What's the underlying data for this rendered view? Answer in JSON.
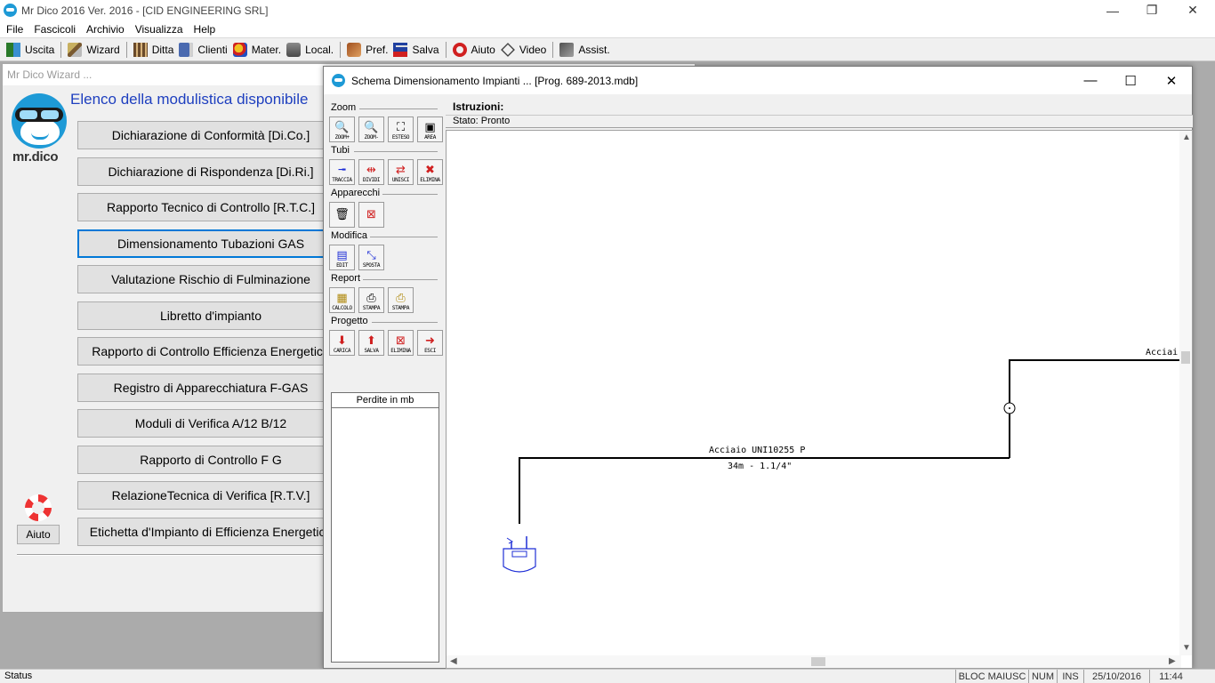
{
  "app": {
    "title": "Mr Dico 2016 Ver. 2016  -  [CID ENGINEERING SRL]",
    "controls": {
      "minimize": "—",
      "restore": "❐",
      "close": "✕"
    }
  },
  "menu": [
    "File",
    "Fascicoli",
    "Archivio",
    "Visualizza",
    "Help"
  ],
  "toolbar": {
    "uscita": "Uscita",
    "wizard": "Wizard",
    "ditta": "Ditta",
    "clienti": "Clienti",
    "mater": "Mater.",
    "local": "Local.",
    "pref": "Pref.",
    "salva": "Salva",
    "aiuto": "Aiuto",
    "video": "Video",
    "assist": "Assist."
  },
  "wizard": {
    "title": "Mr Dico Wizard ...",
    "logo_text": "mr.dico",
    "heading": "Elenco della modulistica disponibile",
    "buttons": [
      "Dichiarazione di Conformità [Di.Co.]",
      "Dichiarazione di Rispondenza [Di.Ri.]",
      "Rapporto Tecnico di Controllo [R.T.C.]",
      "Dimensionamento Tubazioni GAS",
      "Valutazione Rischio di Fulminazione",
      "Libretto d'impianto",
      "Rapporto di Controllo Efficienza Energetica",
      "Registro di Apparecchiatura F-GAS",
      "Moduli di Verifica A/12 B/12",
      "Rapporto di Controllo F G",
      "RelazioneTecnica di Verifica [R.T.V.]",
      "Etichetta d'Impianto di Efficienza Energetica"
    ],
    "aiuto": "Aiuto"
  },
  "schema": {
    "title": "Schema Dimensionamento Impianti ...   [Prog. 689-2013.mdb]",
    "controls": {
      "minimize": "—",
      "maximize": "☐",
      "close": "✕"
    },
    "groups": {
      "zoom": "Zoom",
      "tubi": "Tubi",
      "apparecchi": "Apparecchi",
      "modifica": "Modifica",
      "report": "Report",
      "progetto": "Progetto"
    },
    "tools": {
      "zoom_in": "ZOOM+",
      "zoom_out": "ZOOM-",
      "esteso": "ESTESO",
      "area": "AREA",
      "traccia": "TRACCIA",
      "dividi": "DIVIDI",
      "unisci": "UNISCI",
      "elimina_tubo": "ELIMINA",
      "edit": "EDIT",
      "sposta": "SPOSTA",
      "calcolo": "CALCOLO",
      "stampa1": "STAMPA",
      "stampa2": "STAMPA",
      "carica": "CARICA",
      "salva": "SALVA",
      "elimina_prog": "ELIMINA",
      "esci": "ESCI"
    },
    "perdite_header": "Perdite in mb",
    "istruzioni_label": "Istruzioni:",
    "stato": "Stato: Pronto",
    "pipe1_label": "Acciaio UNI10255 P",
    "pipe1_sub": "34m - 1.1/4\"",
    "pipe2_label": "Acciai"
  },
  "statusbar": {
    "status": "Status",
    "caps": "BLOC MAIUSC",
    "num": "NUM",
    "ins": "INS",
    "date": "25/10/2016",
    "time": "11:44"
  },
  "colors": {
    "heading_blue": "#1e3fbf",
    "logo_blue": "#1e9ad6",
    "focus_border": "#0078d7",
    "appliance_blue": "#1f2fd6"
  }
}
